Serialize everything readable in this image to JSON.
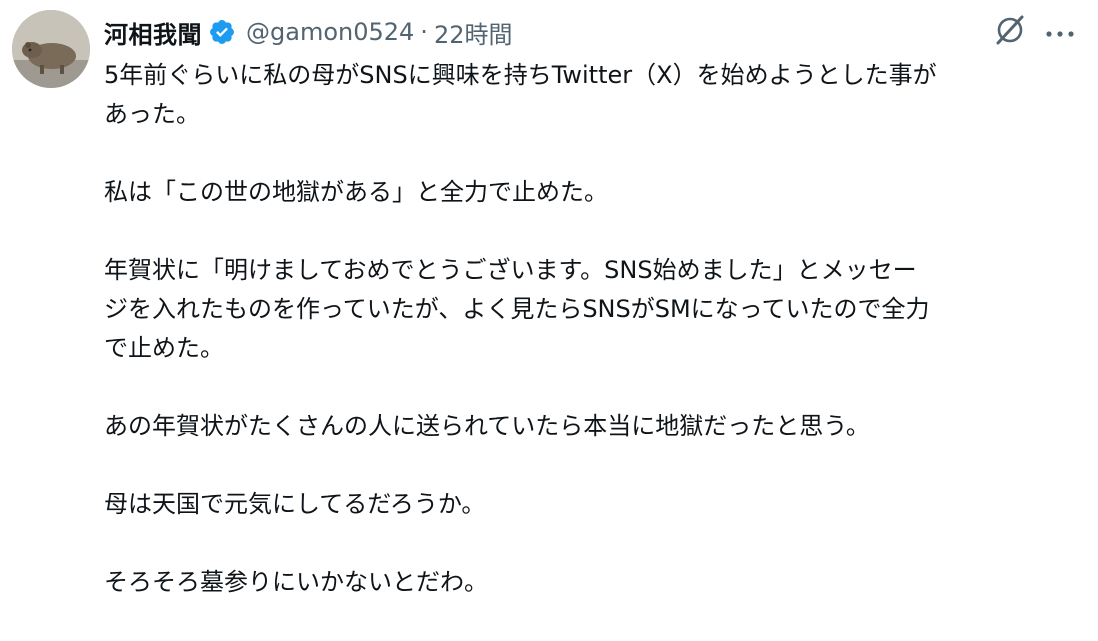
{
  "tweet": {
    "display_name": "河相我聞",
    "handle": "@gamon0524",
    "separator": "·",
    "timestamp": "22時間",
    "verified_icon": "verified-badge-icon",
    "avatar_icon": "capybara-avatar",
    "paragraphs": [
      [
        "5年前ぐらいに私の母がSNSに興味を持ちTwitter（X）を始めようとした事が",
        "あった。"
      ],
      [
        "私は「この世の地獄がある」と全力で止めた。"
      ],
      [
        "年賀状に「明けましておめでとうございます。SNS始めました」とメッセー",
        "ジを入れたものを作っていたが、よく見たらSNSがSMになっていたので全力",
        "で止めた。"
      ],
      [
        "あの年賀状がたくさんの人に送られていたら本当に地獄だったと思う。"
      ],
      [
        "母は天国で元気にしてるだろうか。"
      ],
      [
        "そろそろ墓参りにいかないとだわ。"
      ]
    ]
  },
  "colors": {
    "text_primary": "#0f1419",
    "text_secondary": "#536471",
    "verified_blue": "#1d9bf0",
    "background": "#ffffff"
  },
  "actions": {
    "grok_icon": "grok-icon",
    "more_icon": "more-dots-icon"
  }
}
